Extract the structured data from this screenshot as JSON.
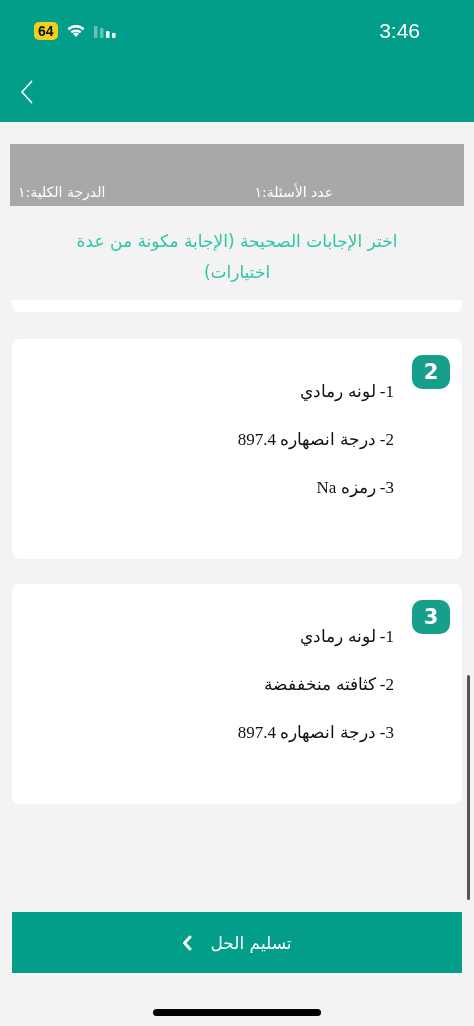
{
  "status_bar": {
    "time": "3:46",
    "battery": "64"
  },
  "header": {
    "back": true
  },
  "summary": {
    "total_grade": "الدرجة الكلية:١",
    "question_count": "عدد الأسئلة:١"
  },
  "instruction": "اختر الإجابات الصحيحة (الإجابة مكونة من عدة اختيارات)",
  "questions": [
    {
      "number": "2",
      "options": [
        "1- لونه رمادي",
        "2- درجة انصهاره 897.4",
        "3- رمزه Na"
      ]
    },
    {
      "number": "3",
      "options": [
        "1- لونه رمادي",
        "2- كثافته منخففضة",
        "3- درجة انصهاره 897.4"
      ]
    }
  ],
  "submit_button": "تسليم الحل"
}
